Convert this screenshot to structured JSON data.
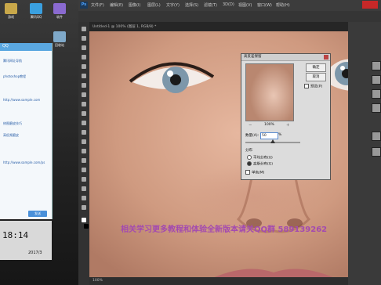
{
  "desktop": {
    "icons": [
      {
        "label": "游戏",
        "color": "#c9a84a"
      },
      {
        "label": "腾讯QQ",
        "color": "#3aa0e0"
      },
      {
        "label": "软件",
        "color": "#8a6ad0"
      },
      {
        "label": "回收站",
        "color": "#7fa9c9"
      }
    ],
    "clock_time": "18:14",
    "clock_date": "2017/3"
  },
  "chat": {
    "title": "QQ",
    "messages": [
      "腾讯网址导航",
      "photoshop教程",
      "http://www.sample.com",
      "修图磨皮技巧",
      "高低频磨皮",
      "http://www.sample.com/ps"
    ],
    "send_label": "发送"
  },
  "photoshop": {
    "logo": "Ps",
    "menus": [
      "文件(F)",
      "编辑(E)",
      "图像(I)",
      "图层(L)",
      "文字(Y)",
      "选择(S)",
      "滤镜(T)",
      "3D(D)",
      "视图(V)",
      "窗口(W)",
      "帮助(H)"
    ],
    "tab_title": "Untitled-1 @ 100% (图层 1, RGB/8) *",
    "status": "100%"
  },
  "dialog": {
    "title": "高反差保留",
    "ok_label": "确定",
    "cancel_label": "取消",
    "preview_label": "预览(P)",
    "zoom": "100%",
    "zoom_minus": "－",
    "zoom_plus": "＋",
    "amount_label": "数量(A):",
    "amount_value": "50",
    "amount_unit": "%",
    "amount_fraction": 0.5,
    "distribution_label": "分布",
    "uniform_label": "平均分布(U)",
    "gaussian_label": "高斯分布(G)",
    "mono_label": "单色(M)"
  },
  "watermark": "相关学习更多教程和体验全新版本请关QQ群 589139262",
  "colors": {
    "ps_bg": "#2b2b2b",
    "dialog_bg": "#dcdcdc",
    "watermark": "#a34ab0",
    "accent": "#4a90d9"
  }
}
